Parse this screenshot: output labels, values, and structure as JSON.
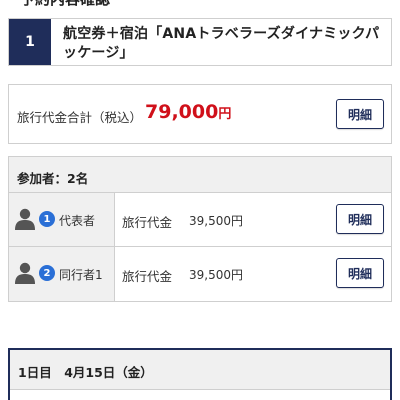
{
  "page": {
    "heading": "予約内容確認"
  },
  "product": {
    "number": "1",
    "title": "航空券＋宿泊「ANAトラベラーズダイナミックパッケージ」"
  },
  "total": {
    "label": "旅行代金合計（税込）",
    "amount": "79,000",
    "currency": "円",
    "detail_button": "明細"
  },
  "passengers": {
    "header": "参加者：2名",
    "rows": [
      {
        "num": "1",
        "role": "代表者",
        "fee_label": "旅行代金",
        "fee_amount": "39,500円",
        "detail_button": "明細"
      },
      {
        "num": "2",
        "role": "同行者1",
        "fee_label": "旅行代金",
        "fee_amount": "39,500円",
        "detail_button": "明細"
      }
    ]
  },
  "itinerary": {
    "day_label": "1日目　4月15日（金）"
  },
  "colors": {
    "navy": "#1f2d5a",
    "price_red": "#d0101a",
    "badge_blue": "#2a6fd6"
  }
}
